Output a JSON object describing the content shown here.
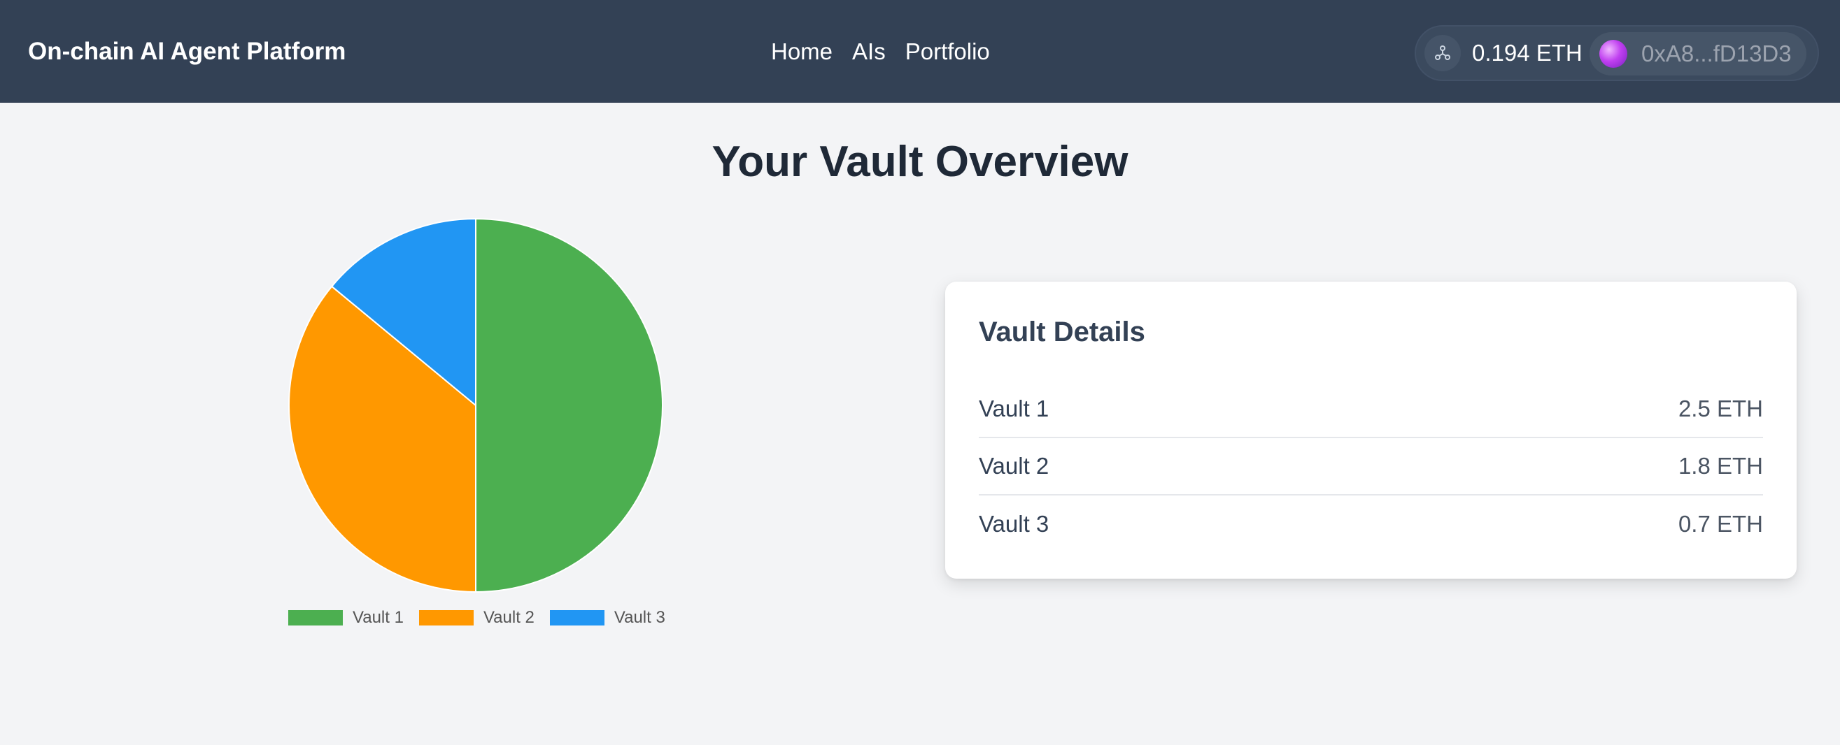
{
  "header": {
    "brand": "On-chain AI Agent Platform",
    "nav": [
      "Home",
      "AIs",
      "Portfolio"
    ],
    "wallet": {
      "network_icon": "network-icon",
      "balance": "0.194 ETH",
      "address": "0xA8...fD13D3"
    }
  },
  "main": {
    "title": "Your Vault Overview"
  },
  "details": {
    "title": "Vault Details",
    "rows": [
      {
        "name": "Vault 1",
        "value": "2.5 ETH"
      },
      {
        "name": "Vault 2",
        "value": "1.8 ETH"
      },
      {
        "name": "Vault 3",
        "value": "0.7 ETH"
      }
    ]
  },
  "chart_data": {
    "type": "pie",
    "categories": [
      "Vault 1",
      "Vault 2",
      "Vault 3"
    ],
    "values": [
      2.5,
      1.8,
      0.7
    ],
    "colors": [
      "#4caf50",
      "#ff9800",
      "#2196f3"
    ],
    "legend": "bottom"
  }
}
